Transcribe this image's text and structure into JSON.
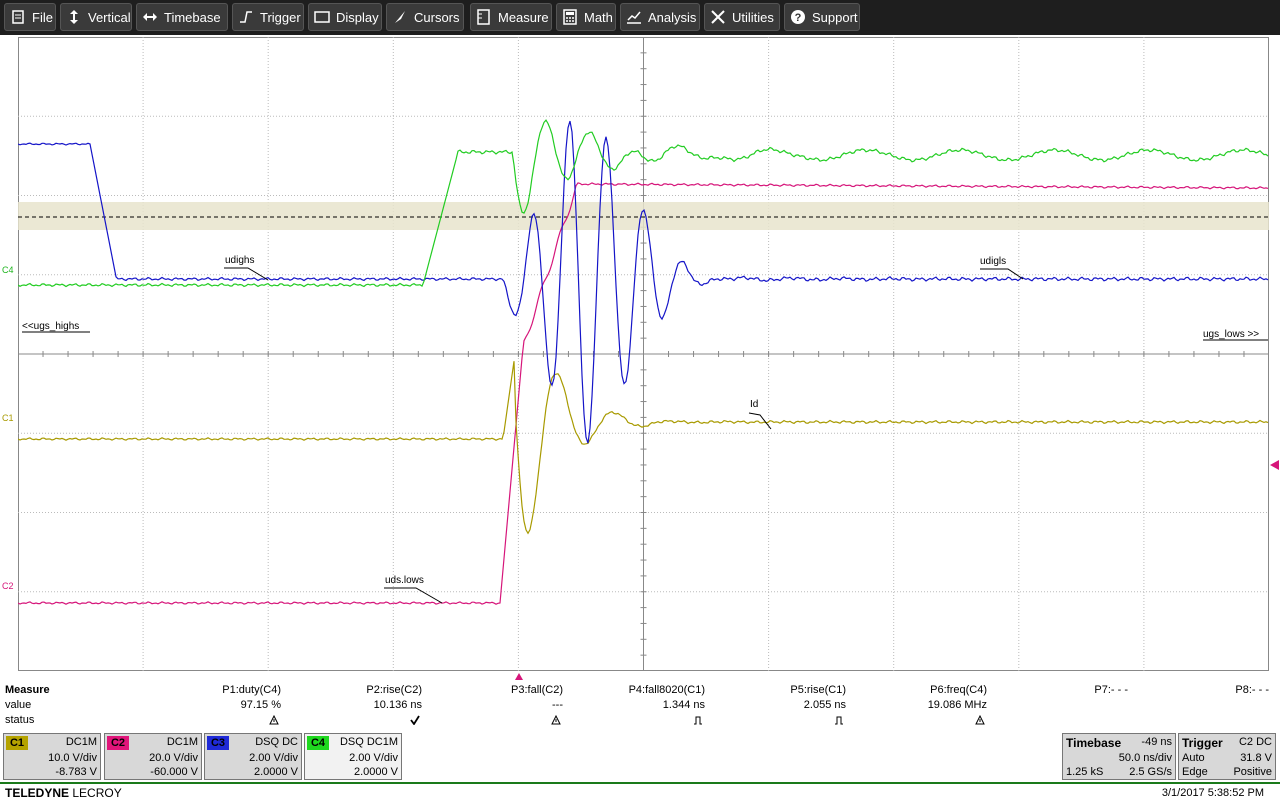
{
  "menu": [
    {
      "label": "File",
      "icon": "file-icon"
    },
    {
      "label": "Vertical",
      "icon": "vertical-icon"
    },
    {
      "label": "Timebase",
      "icon": "timebase-icon"
    },
    {
      "label": "Trigger",
      "icon": "trigger-icon"
    },
    {
      "label": "Display",
      "icon": "display-icon"
    },
    {
      "label": "Cursors",
      "icon": "cursors-icon"
    },
    {
      "label": "Measure",
      "icon": "measure-icon"
    },
    {
      "label": "Math",
      "icon": "math-icon"
    },
    {
      "label": "Analysis",
      "icon": "analysis-icon"
    },
    {
      "label": "Utilities",
      "icon": "utilities-icon"
    },
    {
      "label": "Support",
      "icon": "support-icon"
    }
  ],
  "trace_labels": {
    "c4": "C4",
    "c1": "C1",
    "c2": "C2"
  },
  "annotations": {
    "udighs": "udighs",
    "udigls": "udigls",
    "ugs_highs": "<<ugs_highs",
    "ugs_lows": "ugs_lows >>",
    "id": "Id",
    "uds_lows": "uds.lows"
  },
  "measure": {
    "title": "Measure",
    "row_value": "value",
    "row_status": "status",
    "params": [
      {
        "name": "P1:duty(C4)",
        "value": "97.15 %",
        "status": "warning-icon"
      },
      {
        "name": "P2:rise(C2)",
        "value": "10.136 ns",
        "status": "check-icon"
      },
      {
        "name": "P3:fall(C2)",
        "value": "---",
        "status": "warning-icon"
      },
      {
        "name": "P4:fall8020(C1)",
        "value": "1.344 ns",
        "status": "pulse-icon"
      },
      {
        "name": "P5:rise(C1)",
        "value": "2.055 ns",
        "status": "pulse-icon"
      },
      {
        "name": "P6:freq(C4)",
        "value": "19.086 MHz",
        "status": "warning-icon"
      },
      {
        "name": "P7:- - -",
        "value": "",
        "status": ""
      },
      {
        "name": "P8:- - -",
        "value": "",
        "status": ""
      }
    ]
  },
  "channels": [
    {
      "tag": "C1",
      "coupling": "DC1M",
      "vdiv": "10.0 V/div",
      "offset": "-8.783 V",
      "color": "#b5a300"
    },
    {
      "tag": "C2",
      "coupling": "DC1M",
      "vdiv": "20.0 V/div",
      "offset": "-60.000 V",
      "color": "#e0157a"
    },
    {
      "tag": "C3",
      "coupling": "DSQ  DC",
      "vdiv": "2.00 V/div",
      "offset": "2.0000 V",
      "color": "#1f2ad8"
    },
    {
      "tag": "C4",
      "coupling": "DSQ  DC1M",
      "vdiv": "2.00 V/div",
      "offset": "2.0000 V",
      "color": "#1fd81f"
    }
  ],
  "timebase": {
    "title": "Timebase",
    "delay": "-49 ns",
    "tdiv": "50.0 ns/div",
    "samples": "1.25 kS",
    "rate": "2.5 GS/s"
  },
  "trigger": {
    "title": "Trigger",
    "source": "C2  DC",
    "mode": "Auto",
    "level": "31.8 V",
    "type": "Edge",
    "slope": "Positive"
  },
  "footer": {
    "brand_bold": "TELEDYNE",
    "brand_light": " LECROY",
    "datetime": "3/1/2017 5:38:52 PM"
  },
  "colors": {
    "c1": "#a89a00",
    "c2": "#d6157a",
    "c3": "#1515c8",
    "c4": "#22cc22"
  }
}
